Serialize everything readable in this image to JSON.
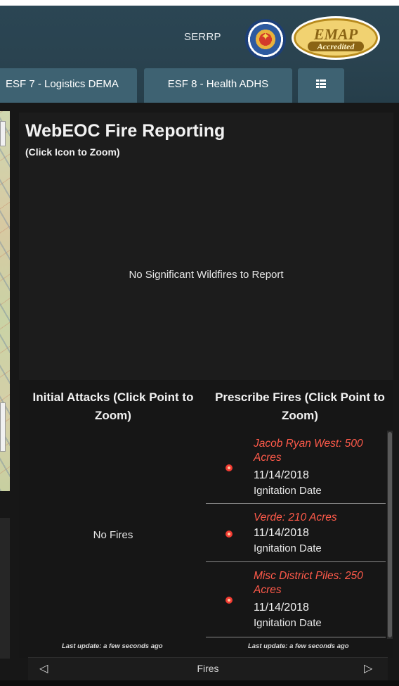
{
  "header": {
    "link_label": "SERRP",
    "seal_icon": "arizona-state-seal-icon",
    "badge_icon": "emap-accredited-badge-icon",
    "badge_text": "EMAP",
    "badge_subtext": "Accredited",
    "background_color": "#2a4350"
  },
  "tabs": [
    {
      "label": "ESF 7 - Logistics DEMA"
    },
    {
      "label": "ESF 8 - Health ADHS"
    },
    {
      "icon": "grid-list-icon"
    }
  ],
  "fire_reporting": {
    "title": "WebEOC Fire Reporting",
    "subtitle": "(Click Icon to Zoom)",
    "empty_message": "No Significant Wildfires to Report"
  },
  "initial_attacks": {
    "heading": "Initial Attacks (Click Point to Zoom)",
    "empty_message": "No Fires",
    "last_update": "Last update: a few seconds ago"
  },
  "prescribe_fires": {
    "heading": "Prescribe Fires (Click Point to Zoom)",
    "items": [
      {
        "name": "Jacob Ryan West: 500 Acres",
        "date": "11/14/2018",
        "date_label": "Ignitation Date"
      },
      {
        "name": "Verde: 210 Acres",
        "date": "11/14/2018",
        "date_label": "Ignitation Date"
      },
      {
        "name": "Misc District Piles: 250 Acres",
        "date": "11/14/2018",
        "date_label": "Ignitation Date"
      }
    ],
    "marker_color": "#f23b32",
    "name_color": "#ff5a4a",
    "last_update": "Last update: a few seconds ago"
  },
  "pager": {
    "prev_icon": "triangle-left-icon",
    "label": "Fires",
    "next_icon": "triangle-right-icon"
  }
}
